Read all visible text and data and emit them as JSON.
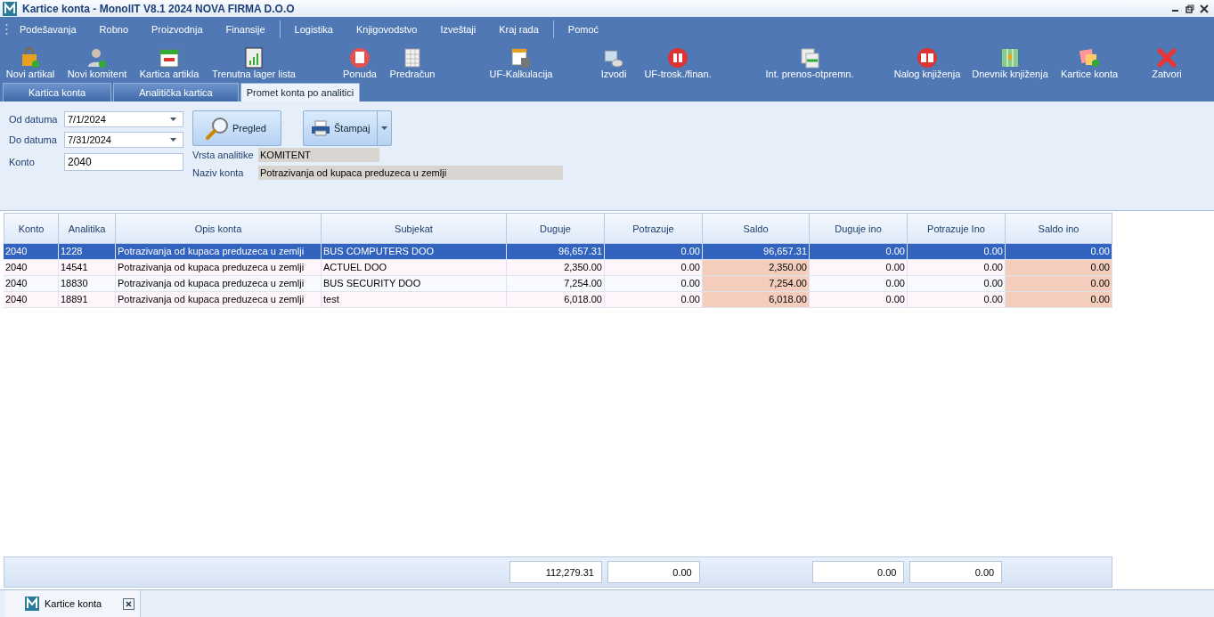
{
  "window": {
    "title": "Kartice konta - MonolIT V8.1 2024 NOVA FIRMA D.O.O"
  },
  "menu_groups": [
    [
      "Podešavanja",
      "Robno",
      "Proizvodnja",
      "Finansije"
    ],
    [
      "Logistika",
      "Knjigovodstvo",
      "Izveštaji",
      "Kraj rada"
    ],
    [
      "Pomoć"
    ]
  ],
  "toolbar": [
    "Novi artikal",
    "Novi komitent",
    "Kartica artikla",
    "Trenutna lager lista",
    "Ponuda",
    "Predračun",
    "UF-Kalkulacija",
    "Izvodi",
    "UF-trosk./finan.",
    "Int. prenos-otpremn.",
    "Nalog knjiženja",
    "Dnevnik knjiženja",
    "Kartice konta",
    "Zatvori"
  ],
  "tabs": [
    {
      "label": "Kartica konta",
      "selected": false
    },
    {
      "label": "Analitička kartica",
      "selected": false
    },
    {
      "label": "Promet konta po analitici",
      "selected": true
    }
  ],
  "form": {
    "od_datuma": {
      "label": "Od datuma",
      "value": "7/1/2024"
    },
    "do_datuma": {
      "label": "Do datuma",
      "value": "7/31/2024"
    },
    "konto": {
      "label": "Konto",
      "value": "2040"
    },
    "vrsta_analitike": {
      "label": "Vrsta analitike",
      "value": "KOMITENT"
    },
    "naziv_konta": {
      "label": "Naziv konta",
      "value": "Potrazivanja od kupaca preduzeca u zemlji"
    },
    "pregled_button": "Pregled",
    "stampaj_button": "Štampaj"
  },
  "table": {
    "columns": [
      {
        "label": "Konto",
        "kind": "text",
        "shaded": false
      },
      {
        "label": "Analitika",
        "kind": "text",
        "shaded": false
      },
      {
        "label": "Opis konta",
        "kind": "text",
        "shaded": false
      },
      {
        "label": "Subjekat",
        "kind": "text",
        "shaded": false
      },
      {
        "label": "Duguje",
        "kind": "amount",
        "shaded": false,
        "total": "112,279.31"
      },
      {
        "label": "Potrazuje",
        "kind": "amount",
        "shaded": false,
        "total": "0.00"
      },
      {
        "label": "Saldo",
        "kind": "amount",
        "shaded": true
      },
      {
        "label": "Duguje ino",
        "kind": "amount",
        "shaded": false,
        "total": "0.00"
      },
      {
        "label": "Potrazuje Ino",
        "kind": "amount",
        "shaded": false,
        "total": "0.00"
      },
      {
        "label": "Saldo ino",
        "kind": "amount",
        "shaded": true
      }
    ],
    "rows": [
      {
        "selected": true,
        "cells": [
          "2040",
          "1228",
          "Potrazivanja od kupaca preduzeca u zemlji",
          "BUS COMPUTERS DOO",
          "96,657.31",
          "0.00",
          "96,657.31",
          "0.00",
          "0.00",
          "0.00"
        ]
      },
      {
        "selected": false,
        "cells": [
          "2040",
          "14541",
          "Potrazivanja od kupaca preduzeca u zemlji",
          "ACTUEL DOO",
          "2,350.00",
          "0.00",
          "2,350.00",
          "0.00",
          "0.00",
          "0.00"
        ]
      },
      {
        "selected": false,
        "cells": [
          "2040",
          "18830",
          "Potrazivanja od kupaca preduzeca u zemlji",
          "BUS SECURITY DOO",
          "7,254.00",
          "0.00",
          "7,254.00",
          "0.00",
          "0.00",
          "0.00"
        ]
      },
      {
        "selected": false,
        "cells": [
          "2040",
          "18891",
          "Potrazivanja od kupaca preduzeca u zemlji",
          "test",
          "6,018.00",
          "0.00",
          "6,018.00",
          "0.00",
          "0.00",
          "0.00"
        ]
      }
    ]
  },
  "document_tabs": [
    {
      "label": "Kartice konta",
      "selected": true
    }
  ]
}
